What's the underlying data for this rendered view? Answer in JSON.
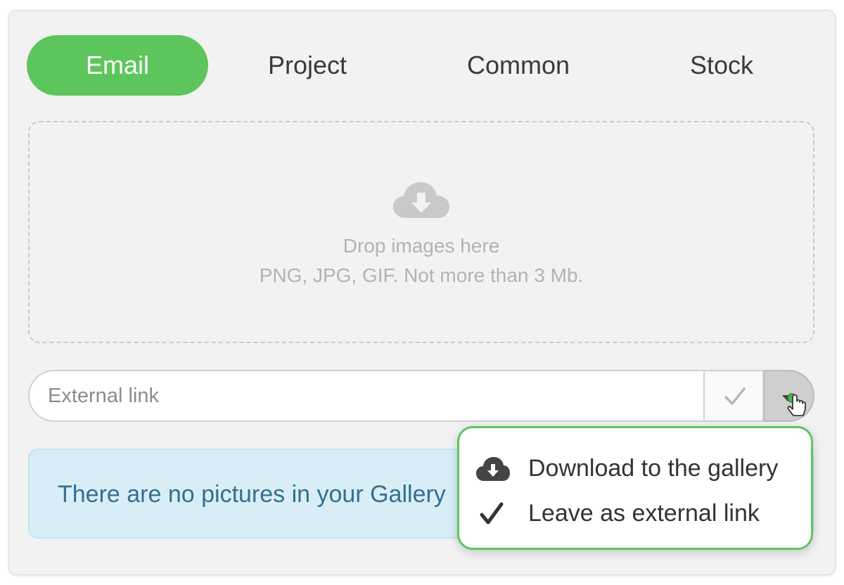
{
  "tabs": [
    {
      "label": "Email",
      "active": true
    },
    {
      "label": "Project",
      "active": false
    },
    {
      "label": "Common",
      "active": false
    },
    {
      "label": "Stock",
      "active": false
    }
  ],
  "dropzone": {
    "icon": "cloud-download-icon",
    "title": "Drop images here",
    "hint": "PNG, JPG, GIF. Not more than 3 Mb."
  },
  "external_link": {
    "placeholder": "External link",
    "value": "",
    "confirm_icon": "check-icon",
    "dropdown_icon": "caret-down-icon"
  },
  "gallery_message": "There are no pictures in your Gallery",
  "link_menu": {
    "items": [
      {
        "label": "Download to the gallery",
        "icon": "cloud-download-icon"
      },
      {
        "label": "Leave as external link",
        "icon": "check-icon"
      }
    ]
  },
  "colors": {
    "accent": "#5cc65c",
    "info_background": "#d9edf7",
    "info_text": "#31708f",
    "muted_text": "#b3b3b3"
  }
}
